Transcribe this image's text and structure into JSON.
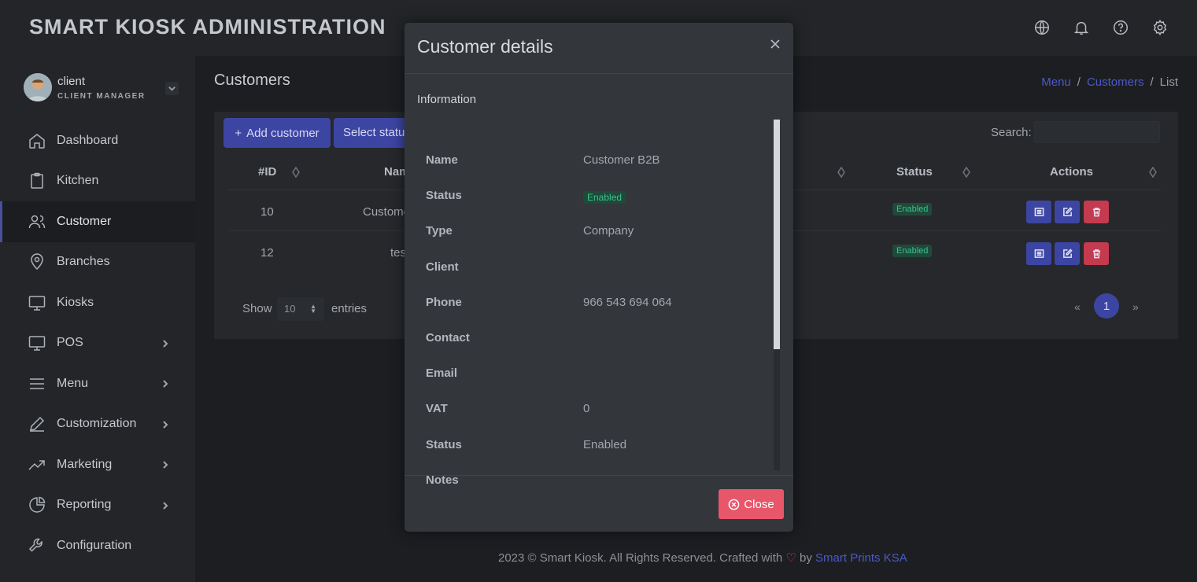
{
  "app": {
    "title": "SMART KIOSK ADMINISTRATION"
  },
  "header_icons": [
    "globe-icon",
    "bell-icon",
    "help-icon",
    "settings-icon"
  ],
  "user": {
    "name": "client",
    "role": "CLIENT MANAGER"
  },
  "sidebar": {
    "items": [
      {
        "label": "Dashboard",
        "icon": "home-icon",
        "has_submenu": false,
        "active": false
      },
      {
        "label": "Kitchen",
        "icon": "clipboard-icon",
        "has_submenu": false,
        "active": false
      },
      {
        "label": "Customer",
        "icon": "users-icon",
        "has_submenu": false,
        "active": true
      },
      {
        "label": "Branches",
        "icon": "map-pin-icon",
        "has_submenu": false,
        "active": false
      },
      {
        "label": "Kiosks",
        "icon": "monitor-icon",
        "has_submenu": false,
        "active": false
      },
      {
        "label": "POS",
        "icon": "monitor-icon",
        "has_submenu": true,
        "active": false
      },
      {
        "label": "Menu",
        "icon": "menu-icon",
        "has_submenu": true,
        "active": false
      },
      {
        "label": "Customization",
        "icon": "pen-icon",
        "has_submenu": true,
        "active": false
      },
      {
        "label": "Marketing",
        "icon": "trending-up-icon",
        "has_submenu": true,
        "active": false
      },
      {
        "label": "Reporting",
        "icon": "pie-chart-icon",
        "has_submenu": true,
        "active": false
      },
      {
        "label": "Configuration",
        "icon": "wrench-icon",
        "has_submenu": false,
        "active": false
      }
    ]
  },
  "page": {
    "title": "Customers",
    "breadcrumb": [
      "Menu",
      "Customers",
      "List"
    ]
  },
  "toolbar": {
    "add_label": "Add customer",
    "status_label": "Select status",
    "search_label": "Search:",
    "search_value": ""
  },
  "table": {
    "headers": {
      "id": "#ID",
      "name": "Name",
      "status": "Status",
      "actions": "Actions"
    },
    "rows": [
      {
        "id": "10",
        "name": "Customer B2B",
        "status": "Enabled"
      },
      {
        "id": "12",
        "name": "test",
        "status": "Enabled"
      }
    ]
  },
  "pagination": {
    "show_label": "Show",
    "page_size": "10",
    "entries_label": "entries",
    "prev": "«",
    "current": "1",
    "next": "»"
  },
  "footer": {
    "text": "2023 © Smart Kiosk. All Rights Reserved. Crafted with",
    "by": "by",
    "link": "Smart Prints KSA"
  },
  "modal": {
    "title": "Customer details",
    "section": "Information",
    "fields": [
      {
        "label": "Name",
        "value": "Customer B2B",
        "badge": false
      },
      {
        "label": "Status",
        "value": "Enabled",
        "badge": true
      },
      {
        "label": "Type",
        "value": "Company",
        "badge": false
      },
      {
        "label": "Client",
        "value": "",
        "badge": false
      },
      {
        "label": "Phone",
        "value": "966 543 694 064",
        "badge": false
      },
      {
        "label": "Contact",
        "value": "",
        "badge": false
      },
      {
        "label": "Email",
        "value": "",
        "badge": false
      },
      {
        "label": "VAT",
        "value": "0",
        "badge": false
      },
      {
        "label": "Status",
        "value": "Enabled",
        "badge": false
      },
      {
        "label": "Notes",
        "value": "",
        "badge": false
      }
    ],
    "close_label": "Close"
  },
  "colors": {
    "accent": "#3d45a3",
    "danger": "#e8566a",
    "success": "#3ac28c",
    "link": "#4d58c4"
  }
}
